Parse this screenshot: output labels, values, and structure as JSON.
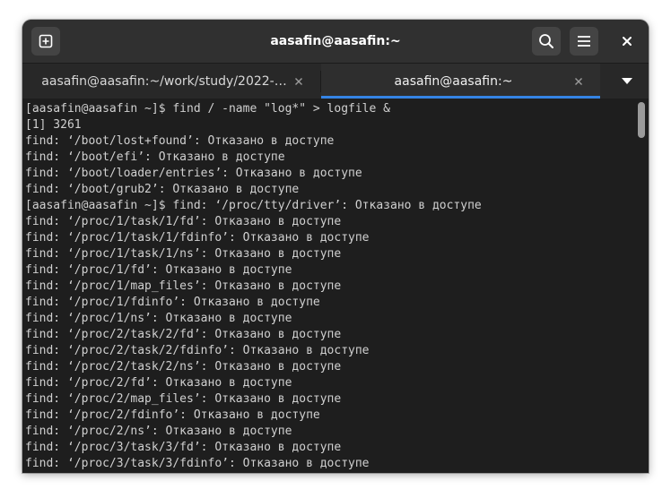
{
  "window": {
    "title": "aasafin@aasafin:~"
  },
  "headerbar": {
    "new_tab_icon": "new-tab-icon",
    "search_icon": "search-icon",
    "menu_icon": "hamburger-menu-icon",
    "close_icon": "close-icon"
  },
  "tabs": [
    {
      "label": "aasafin@aasafin:~/work/study/2022-…",
      "active": false
    },
    {
      "label": "aasafin@aasafin:~",
      "active": true
    }
  ],
  "tab_overflow_icon": "dropdown-triangle-icon",
  "colors": {
    "accent": "#3584e4",
    "terminal_bg": "#1e1e1e",
    "terminal_fg": "#d0d0d0",
    "headerbar_bg": "#303030"
  },
  "terminal": {
    "lines": [
      "[aasafin@aasafin ~]$ find / -name \"log*\" > logfile &",
      "[1] 3261",
      "find: ‘/boot/lost+found’: Отказано в доступе",
      "find: ‘/boot/efi’: Отказано в доступе",
      "find: ‘/boot/loader/entries’: Отказано в доступе",
      "find: ‘/boot/grub2’: Отказано в доступе",
      "[aasafin@aasafin ~]$ find: ‘/proc/tty/driver’: Отказано в доступе",
      "find: ‘/proc/1/task/1/fd’: Отказано в доступе",
      "find: ‘/proc/1/task/1/fdinfo’: Отказано в доступе",
      "find: ‘/proc/1/task/1/ns’: Отказано в доступе",
      "find: ‘/proc/1/fd’: Отказано в доступе",
      "find: ‘/proc/1/map_files’: Отказано в доступе",
      "find: ‘/proc/1/fdinfo’: Отказано в доступе",
      "find: ‘/proc/1/ns’: Отказано в доступе",
      "find: ‘/proc/2/task/2/fd’: Отказано в доступе",
      "find: ‘/proc/2/task/2/fdinfo’: Отказано в доступе",
      "find: ‘/proc/2/task/2/ns’: Отказано в доступе",
      "find: ‘/proc/2/fd’: Отказано в доступе",
      "find: ‘/proc/2/map_files’: Отказано в доступе",
      "find: ‘/proc/2/fdinfo’: Отказано в доступе",
      "find: ‘/proc/2/ns’: Отказано в доступе",
      "find: ‘/proc/3/task/3/fd’: Отказано в доступе",
      "find: ‘/proc/3/task/3/fdinfo’: Отказано в доступе"
    ]
  }
}
